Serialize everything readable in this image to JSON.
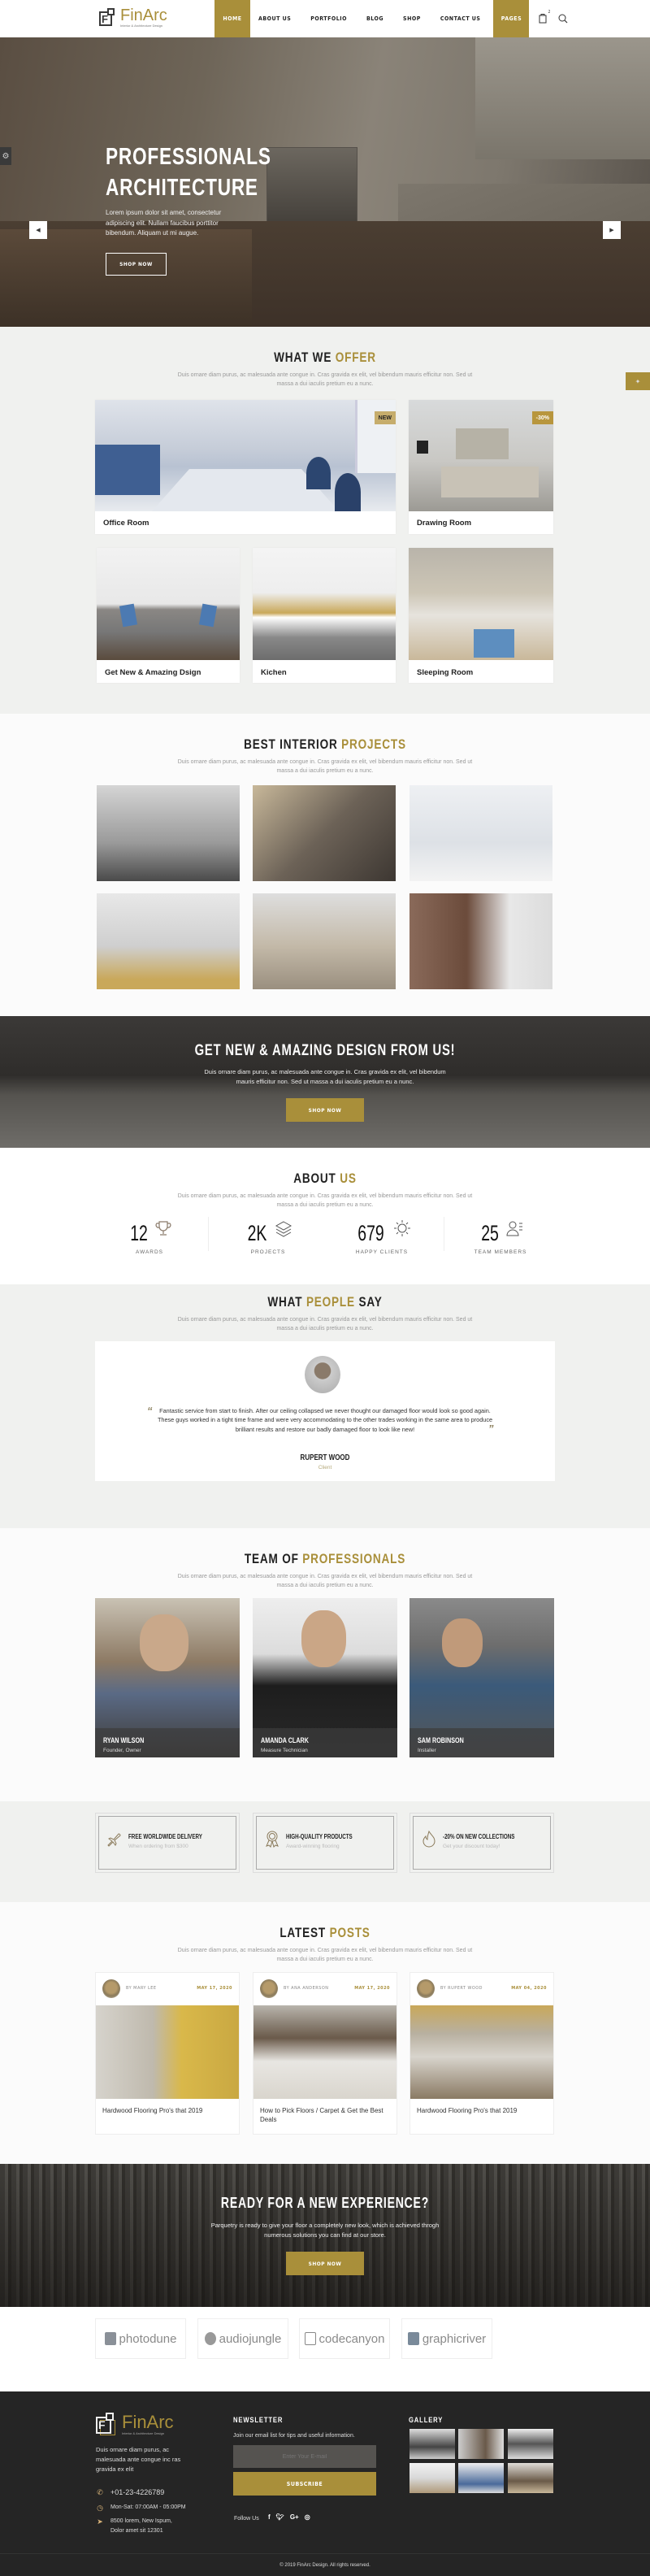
{
  "header": {
    "logo_name": "FinArc",
    "logo_sub": "Interior & Architecture Design",
    "nav": [
      {
        "label": "HOME",
        "active": true
      },
      {
        "label": "ABOUT US",
        "active": false
      },
      {
        "label": "PORTFOLIO",
        "active": false
      },
      {
        "label": "BLOG",
        "active": false
      },
      {
        "label": "SHOP",
        "active": false
      },
      {
        "label": "CONTACT US",
        "active": false
      },
      {
        "label": "PAGES",
        "active": true
      }
    ],
    "cart_count": "2",
    "icons": [
      "shopping-bag-icon",
      "search-icon"
    ]
  },
  "hero": {
    "title_line1": "PROFESSIONALS",
    "title_line2": "ARCHITECTURE",
    "text": "Lorem ipsum dolor sit amet, consectetur adipiscing elit. Nullam faucibus porttitor bibendum. Aliquam ut mi augue.",
    "button": "SHOP NOW",
    "prev_icon": "chevron-left-icon",
    "next_icon": "chevron-right-icon",
    "settings_icon": "gear-icon"
  },
  "section_desc": "Duis ornare diam purus, ac malesuada ante congue in. Cras gravida ex elit, vel bibendum mauris efficitur non. Sed ut massa a dui iaculis pretium eu a nunc.",
  "offer": {
    "title_a": "WHAT WE ",
    "title_b": "OFFER",
    "cards": [
      {
        "caption": "Office Room",
        "badge": "NEW"
      },
      {
        "caption": "Drawing Room",
        "badge": "-30%"
      },
      {
        "caption": "Get New & Amazing Dsign"
      },
      {
        "caption": "Kichen"
      },
      {
        "caption": "Sleeping Room"
      }
    ]
  },
  "projects": {
    "title_a": "BEST INTERIOR ",
    "title_b": "PROJECTS"
  },
  "banner": {
    "title": "GET NEW & AMAZING DESIGN FROM US!",
    "text": "Duis ornare diam purus, ac malesuada ante congue in. Cras gravida ex elit, vel bibendum mauris efficitur non. Sed ut massa a dui iaculis pretium eu a nunc.",
    "button": "SHOP NOW"
  },
  "about": {
    "title_a": "ABOUT ",
    "title_b": "US",
    "stats": [
      {
        "value": "12",
        "label": "AWARDS",
        "icon": "trophy-icon"
      },
      {
        "value": "2K",
        "label": "PROJECTS",
        "icon": "layers-icon"
      },
      {
        "value": "679",
        "label": "HAPPY CLIENTS",
        "icon": "sun-icon"
      },
      {
        "value": "25",
        "label": "TEAM MEMBERS",
        "icon": "team-icon"
      }
    ]
  },
  "testimonials": {
    "title_a": "WHAT ",
    "title_b": "PEOPLE",
    "title_c": " SAY",
    "quote": "Fantastic service from start to finish. After our ceiling collapsed we never thought our damaged floor would look so good again. These guys worked in a tight time frame and were very accommodating to the other trades working in the same area to produce brilliant results and restore our badly damaged floor to look like new!",
    "name": "RUPERT WOOD",
    "role": "Client"
  },
  "team": {
    "title_a": "TEAM OF ",
    "title_b": "PROFESSIONALS",
    "members": [
      {
        "name": "RYAN WILSON",
        "role": "Founder, Owner"
      },
      {
        "name": "AMANDA CLARK",
        "role": "Measure Technician"
      },
      {
        "name": "SAM ROBINSON",
        "role": "Installer"
      }
    ]
  },
  "features": [
    {
      "title": "FREE WORLDWIDE DELIVERY",
      "sub": "When ordering from $300",
      "icon": "airplane-icon"
    },
    {
      "title": "HIGH-QUALITY PRODUCTS",
      "sub": "Award-winning flooring",
      "icon": "award-ribbon-icon"
    },
    {
      "title": "-20% ON NEW COLLECTIONS",
      "sub": "Get your discount today!",
      "icon": "flame-icon"
    }
  ],
  "posts": {
    "title_a": "LATEST ",
    "title_b": "POSTS",
    "items": [
      {
        "author": "BY MARY LEE",
        "date": "MAY 17, 2020",
        "title": "Hardwood Flooring Pro's that 2019"
      },
      {
        "author": "BY ANA ANDERSON",
        "date": "MAY 17, 2020",
        "title": "How to Pick Floors / Carpet & Get the Best Deals"
      },
      {
        "author": "BY RUPERT WOOD",
        "date": "MAY 04, 2020",
        "title": "Hardwood Flooring Pro's that 2019"
      }
    ]
  },
  "cta": {
    "title": "READY FOR A NEW EXPERIENCE?",
    "text": "Parquetry is ready to give your floor a completely new look, which is achieved throgh numerous solutions you can find at our store.",
    "button": "SHOP NOW"
  },
  "brands": [
    "photodune",
    "audiojungle",
    "codecanyon",
    "graphicriver"
  ],
  "footer": {
    "logo_name": "FinArc",
    "logo_sub": "Interior & Architecture Design",
    "desc": "Duis ornare diam purus, ac malesuada ante congue inc ras gravida ex elit",
    "phone": "+01-23-4226789",
    "hours": "Mon-Sat: 07:00AM - 05:00PM",
    "address": "8500 lorem, New Ispum, Dolor amet sit 12301",
    "newsletter_title": "NEWSLETTER",
    "newsletter_text": "Join our email list for tips and useful information.",
    "email_placeholder": "Enter Your E-mail",
    "subscribe": "SUBSCRIBE",
    "follow": "Follow Us",
    "social": [
      "f",
      "t",
      "G+",
      "ig"
    ],
    "gallery_title": "GALLERY",
    "copyright": "© 2019 FinArc Design. All rights reserved."
  },
  "colors": {
    "accent": "#a98f3a",
    "dark": "#252525",
    "light_bg": "#f0f1ef"
  }
}
